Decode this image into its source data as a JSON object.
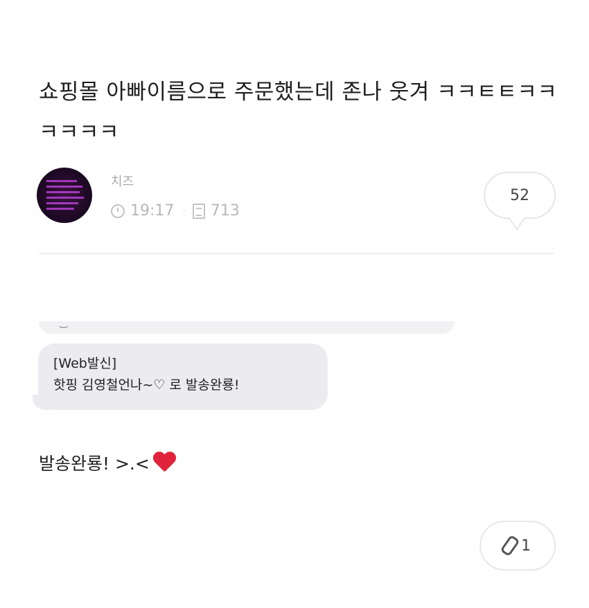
{
  "post": {
    "title": "쇼핑몰 아빠이름으로 주문했는데 존나 웃겨 ㅋㅋㅌㅌㅋㅋㅋㅋㅋㅋ",
    "author": "치즈",
    "time": "19:17",
    "views": "713",
    "comment_count": "52"
  },
  "sms": {
    "header": "[Web발신]",
    "message": "핫핑 김영철언나~♡ 로 발송완룡!"
  },
  "body": {
    "text": "발송완룡! >.<"
  },
  "attachment": {
    "count": "1"
  },
  "icons": {
    "time": "clock-icon",
    "views": "document-icon",
    "attachment": "paperclip-icon",
    "heart": "heart-emoji",
    "comments": "speech-bubble-icon"
  },
  "colors": {
    "sms_bubble": "#ececf0",
    "heart": "#e0233b",
    "avatar": "#2a0d33"
  }
}
